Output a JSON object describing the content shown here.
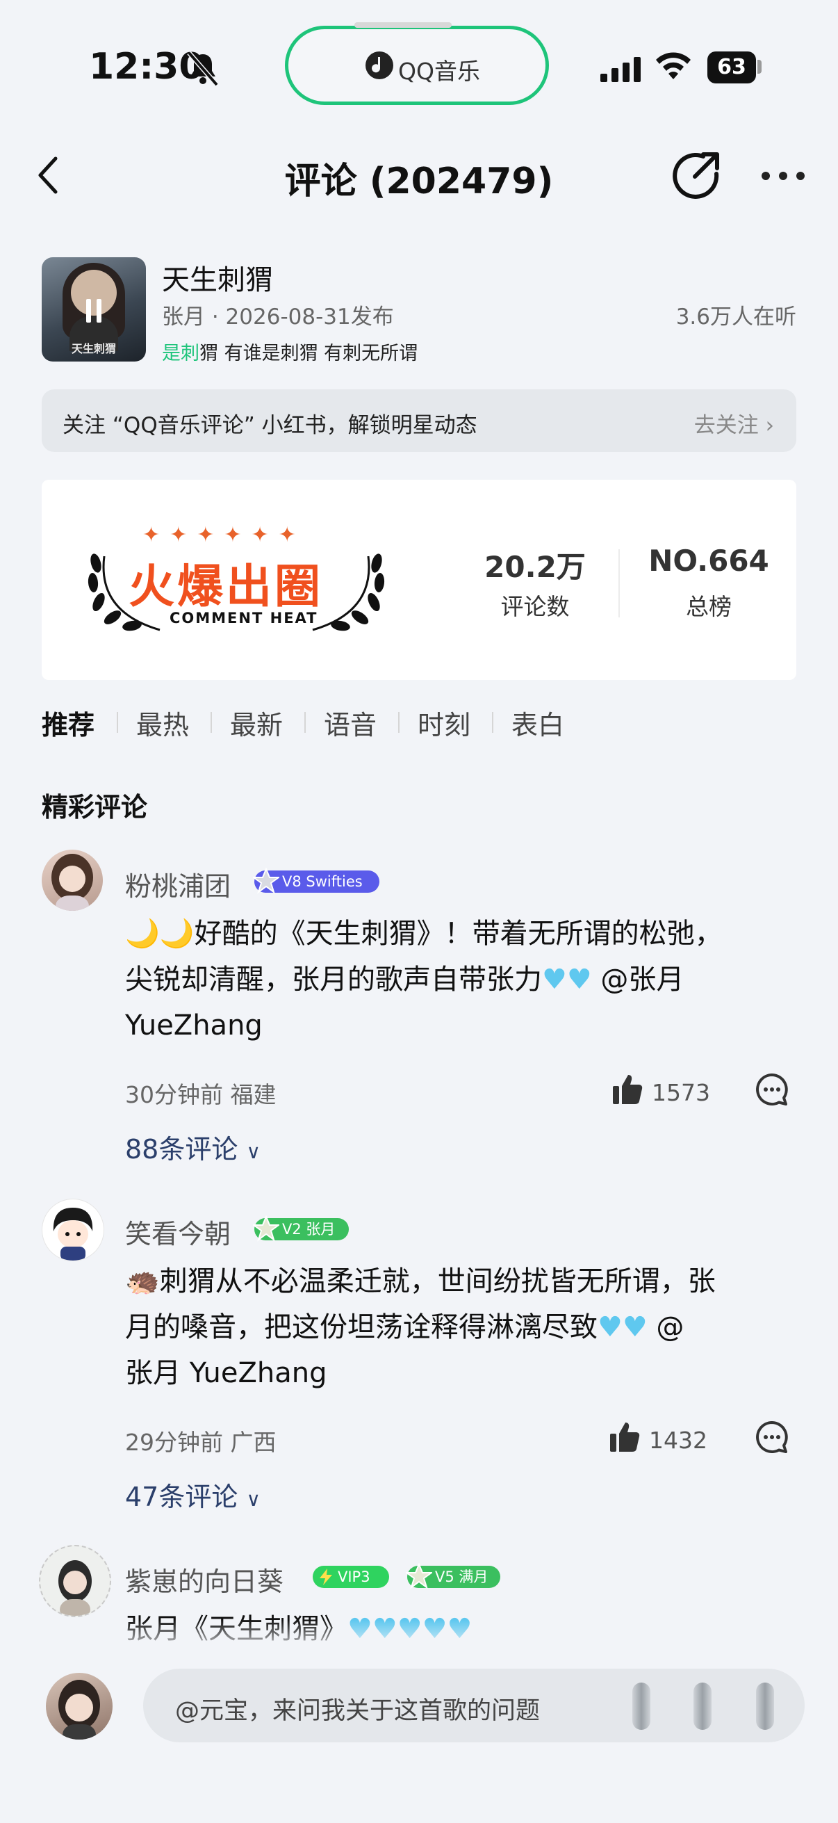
{
  "status_bar": {
    "time": "12:30",
    "dynamic_island_app": "QQ音乐",
    "battery": "63"
  },
  "header": {
    "title": "评论 (202479)"
  },
  "song": {
    "title": "天生刺猬",
    "meta": "张月 · 2026-08-31发布",
    "listeners": "3.6万人在听",
    "lyric_highlight": "是刺",
    "lyric_rest": "猬 有谁是刺猬 有刺无所谓",
    "cover_text": "天生刺猬"
  },
  "follow_bar": {
    "text": "关注 “QQ音乐评论” 小红书，解锁明星动态",
    "button": "去关注"
  },
  "heat_card": {
    "logo_text": "火爆出圈",
    "logo_sub": "COMMENT HEAT",
    "comment_count": "20.2万",
    "comment_count_label": "评论数",
    "rank": "NO.664",
    "rank_label": "总榜"
  },
  "tabs": [
    "推荐",
    "最热",
    "最新",
    "语音",
    "时刻",
    "表白"
  ],
  "section_title": "精彩评论",
  "comments": [
    {
      "username": "粉桃浦团",
      "badges": [
        {
          "text": "V8 Swifties",
          "color": "#5a5bea"
        }
      ],
      "lines": [
        "🌙🌙好酷的《天生刺猬》！带着无所谓的松弛，",
        "尖锐却清醒，张月的歌声自带张力",
        "YueZhang"
      ],
      "line2_suffix": " @张月",
      "meta": "30分钟前 福建",
      "likes": "1573",
      "replies": "88条评论"
    },
    {
      "username": "笑看今朝",
      "badges": [
        {
          "text": "V2 张月",
          "color": "#3bbf5f"
        }
      ],
      "lines": [
        "🦔刺猬从不必温柔迁就，世间纷扰皆无所谓，张",
        "月的嗓音，把这份坦荡诠释得淋漓尽致",
        "张月 YueZhang"
      ],
      "line2_suffix": " @",
      "meta": "29分钟前 广西",
      "likes": "1432",
      "replies": "47条评论"
    },
    {
      "username": "紫崽的向日葵",
      "badges": [
        {
          "text": "VIP3",
          "color": "#2fd35f"
        },
        {
          "text": "V5 满月",
          "color": "#3bbf5f"
        }
      ],
      "lines": [
        "张月《天生刺猬》"
      ]
    }
  ],
  "bottom_bar": {
    "placeholder": "@元宝，来问我关于这首歌的问题"
  },
  "colors": {
    "accent_green": "#1ec47a",
    "reply_link": "#2b3f6b",
    "heat_orange": "#f0501e",
    "background": "#f2f4f8"
  }
}
